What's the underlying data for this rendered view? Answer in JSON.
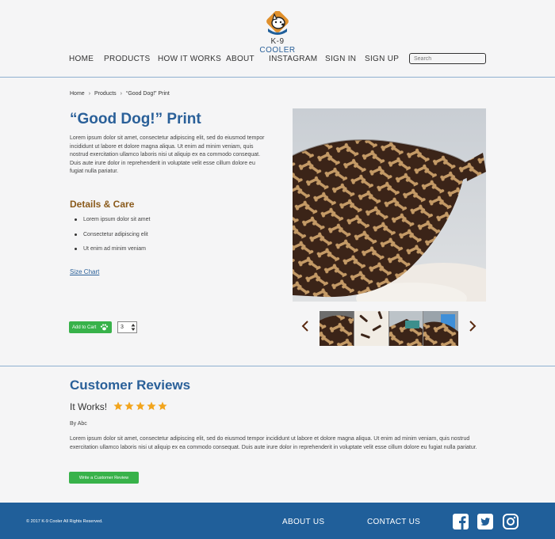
{
  "brand": {
    "name_prefix": "K-9",
    "name_suffix": " COOLER"
  },
  "nav": {
    "home": "HOME",
    "products": "PRODUCTS",
    "how": "HOW IT WORKS",
    "about": "ABOUT",
    "instagram": "INSTAGRAM",
    "signin": "SIGN IN",
    "signup": "SIGN UP"
  },
  "search": {
    "placeholder": "Search"
  },
  "breadcrumb": {
    "home": "Home",
    "products": "Products",
    "current": "“Good Dog!” Print",
    "separator": "›"
  },
  "product": {
    "title": "“Good Dog!” Print",
    "description": "Lorem ipsum dolor sit amet, consectetur adipiscing elit, sed do eiusmod tempor incididunt ut labore et dolore magna aliqua. Ut enim ad minim veniam, quis nostrud exercitation ullamco laboris nisi ut aliquip ex ea commodo consequat. Duis aute irure dolor in reprehenderit in voluptate velit esse cillum dolore eu fugiat nulla pariatur.",
    "details_title": "Details & Care",
    "details": [
      "Lorem ipsum dolor sit amet",
      "Consectetur adipiscing elit",
      "Ut enim ad minim veniam"
    ],
    "size_chart": "Size Chart",
    "add_to_cart": "Add to Cart",
    "quantity": "3"
  },
  "reviews": {
    "title": "Customer Reviews",
    "review_title": "It Works!",
    "rating": 5,
    "author": "By Abc",
    "body": "Lorem ipsum dolor sit amet, consectetur adipiscing elit, sed do eiusmod tempor incididunt ut labore et dolore magna aliqua. Ut enim ad minim veniam, quis nostrud exercitation ullamco laboris nisi ut aliquip ex ea commodo consequat. Duis aute irure dolor in reprehenderit in voluptate velit esse cillum dolore eu fugiat nulla pariatur.",
    "write_button": "Write a Customer Review"
  },
  "footer": {
    "copyright": "©  2017 K-9 Cooler All Rights Reserved.",
    "about": "ABOUT US",
    "contact": "CONTACT US",
    "social_icons": [
      "facebook-icon",
      "twitter-icon",
      "instagram-icon"
    ]
  },
  "colors": {
    "accent_blue": "#2a6099",
    "footer_blue": "#205f9a",
    "green": "#38b24a",
    "details_brown": "#8a5a1b",
    "star": "#f2a51d"
  }
}
